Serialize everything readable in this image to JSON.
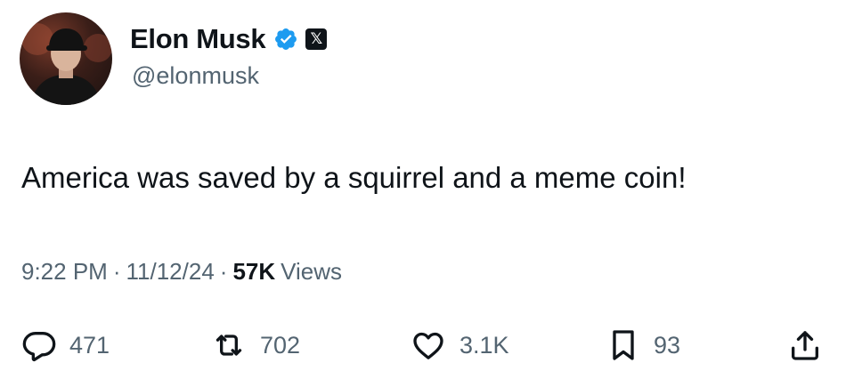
{
  "author": {
    "display_name": "Elon Musk",
    "handle": "@elonmusk",
    "verified_color": "#1d9bf0",
    "badge_icon": "x-logo-icon",
    "badge_glyph": "𝕏"
  },
  "tweet": {
    "text": "America was saved by a squirrel and a meme coin!"
  },
  "meta": {
    "time": "9:22 PM",
    "separator": "·",
    "date": "11/12/24",
    "views_count": "57K",
    "views_label": "Views"
  },
  "actions": {
    "replies": "471",
    "retweets": "702",
    "likes": "3.1K",
    "bookmarks": "93"
  },
  "colors": {
    "text_primary": "#0f1419",
    "text_secondary": "#536471",
    "accent": "#1d9bf0"
  }
}
